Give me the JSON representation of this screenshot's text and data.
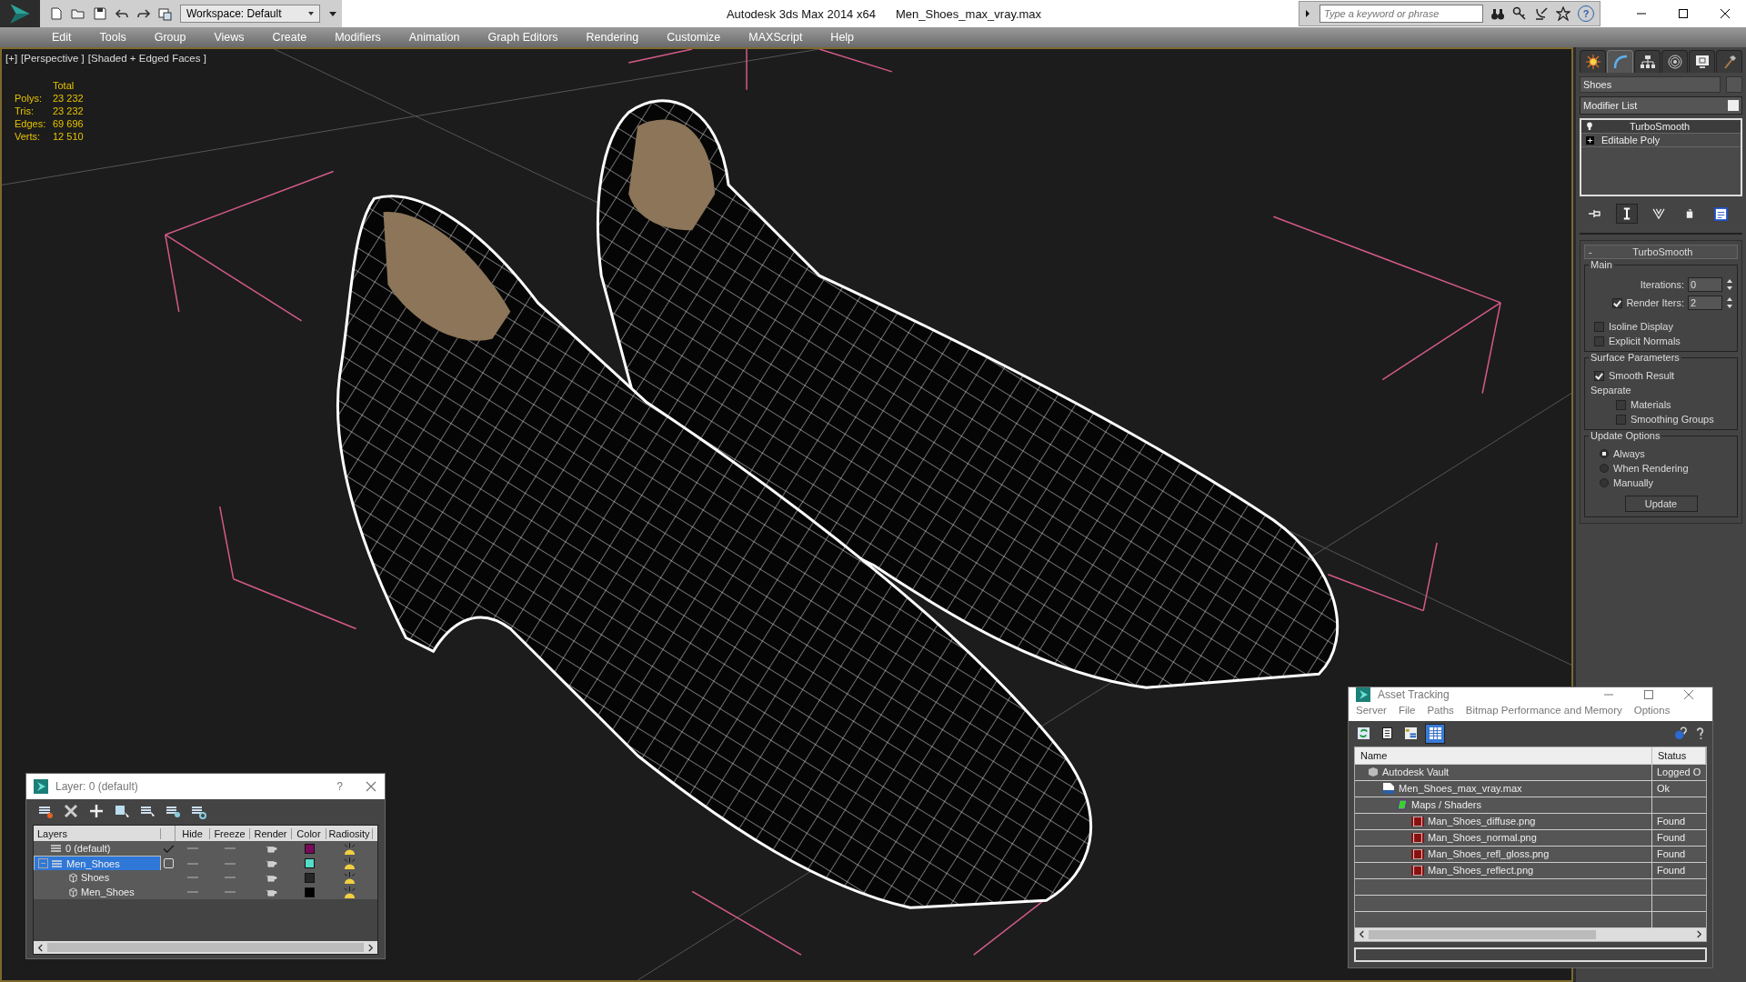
{
  "window": {
    "app_title": "Autodesk 3ds Max  2014 x64",
    "file_title": "Men_Shoes_max_vray.max"
  },
  "quick_access": {
    "workspace": "Workspace: Default"
  },
  "search": {
    "placeholder": "Type a keyword or phrase",
    "help": "?"
  },
  "menu": [
    "Edit",
    "Tools",
    "Group",
    "Views",
    "Create",
    "Modifiers",
    "Animation",
    "Graph Editors",
    "Rendering",
    "Customize",
    "MAXScript",
    "Help"
  ],
  "viewport": {
    "labels": [
      "[+]",
      "[Perspective ]",
      "[Shaded + Edged Faces ]"
    ],
    "stats": {
      "header": "Total",
      "rows": [
        {
          "label": "Polys:",
          "value": "23 232"
        },
        {
          "label": "Tris:",
          "value": "23 232"
        },
        {
          "label": "Edges:",
          "value": "69 696"
        },
        {
          "label": "Verts:",
          "value": "12 510"
        }
      ]
    }
  },
  "command_panel": {
    "tabs": [
      {
        "kind": "create",
        "selected": false
      },
      {
        "kind": "modify",
        "selected": true
      },
      {
        "kind": "hierarchy",
        "selected": false
      },
      {
        "kind": "motion",
        "selected": false
      },
      {
        "kind": "display",
        "selected": false
      },
      {
        "kind": "utilities",
        "selected": false
      }
    ],
    "object_name": "Shoes",
    "modifier_list": "Modifier List",
    "stack": [
      {
        "kind": "modifier",
        "label": "TurboSmooth"
      },
      {
        "kind": "base",
        "label": "Editable Poly"
      }
    ],
    "stack_tools": [
      {
        "kind": "pin",
        "on": false
      },
      {
        "kind": "end_result",
        "on": true
      },
      {
        "kind": "unique",
        "on": false
      },
      {
        "kind": "remove",
        "on": false
      },
      {
        "kind": "configure",
        "on": false
      }
    ],
    "rollout": {
      "toggle": "-",
      "title": "TurboSmooth",
      "main": {
        "title": "Main",
        "iterations": {
          "label": "Iterations:",
          "value": "0"
        },
        "render_iters": {
          "label": "Render Iters:",
          "value": "2",
          "checked": true
        },
        "options": [
          {
            "label": "Isoline Display",
            "checked": false
          },
          {
            "label": "Explicit Normals",
            "checked": false
          }
        ]
      },
      "surface": {
        "title": "Surface Parameters",
        "smooth_result": {
          "label": "Smooth Result",
          "checked": true
        },
        "separate": "Separate",
        "options": [
          {
            "label": "Materials",
            "checked": false
          },
          {
            "label": "Smoothing Groups",
            "checked": false
          }
        ]
      },
      "update": {
        "title": "Update Options",
        "options": [
          {
            "label": "Always",
            "selected": true
          },
          {
            "label": "When Rendering",
            "selected": false
          },
          {
            "label": "Manually",
            "selected": false
          }
        ],
        "button": "Update"
      }
    }
  },
  "layer_dialog": {
    "title": "Layer: 0 (default)",
    "help": "?",
    "columns": [
      "Layers",
      "Hide",
      "Freeze",
      "Render",
      "Color",
      "Radiosity"
    ],
    "rows": [
      {
        "kind": "layer",
        "name": "0 (default)",
        "current": true,
        "selected": false,
        "color": "#7a0a5a"
      },
      {
        "kind": "layer",
        "name": "Men_Shoes",
        "current": false,
        "selected": true,
        "expanded": true,
        "color": "#55dcc8",
        "children": [
          {
            "kind": "object",
            "name": "Shoes",
            "color": "#262626"
          },
          {
            "kind": "object",
            "name": "Men_Shoes",
            "color": "#000000"
          }
        ]
      }
    ]
  },
  "asset_tracking": {
    "title": "Asset Tracking",
    "menu": [
      "Server",
      "File",
      "Paths",
      "Bitmap Performance and Memory",
      "Options"
    ],
    "toolbar": [
      {
        "kind": "refresh",
        "selected": false
      },
      {
        "kind": "list",
        "selected": false
      },
      {
        "kind": "tree",
        "selected": false
      },
      {
        "kind": "table",
        "selected": true
      }
    ],
    "columns": [
      "Name",
      "Status"
    ],
    "rows": [
      {
        "kind": "vault",
        "name": "Autodesk Vault",
        "status": "Logged O",
        "children": [
          {
            "kind": "max",
            "name": "Men_Shoes_max_vray.max",
            "status": "Ok",
            "children": [
              {
                "kind": "folder",
                "name": "Maps / Shaders",
                "children": [
                  {
                    "kind": "png",
                    "name": "Man_Shoes_diffuse.png",
                    "status": "Found"
                  },
                  {
                    "kind": "png",
                    "name": "Man_Shoes_normal.png",
                    "status": "Found"
                  },
                  {
                    "kind": "png",
                    "name": "Man_Shoes_refl_gloss.png",
                    "status": "Found"
                  },
                  {
                    "kind": "png",
                    "name": "Man_Shoes_reflect.png",
                    "status": "Found"
                  }
                ]
              }
            ]
          }
        ]
      }
    ]
  }
}
